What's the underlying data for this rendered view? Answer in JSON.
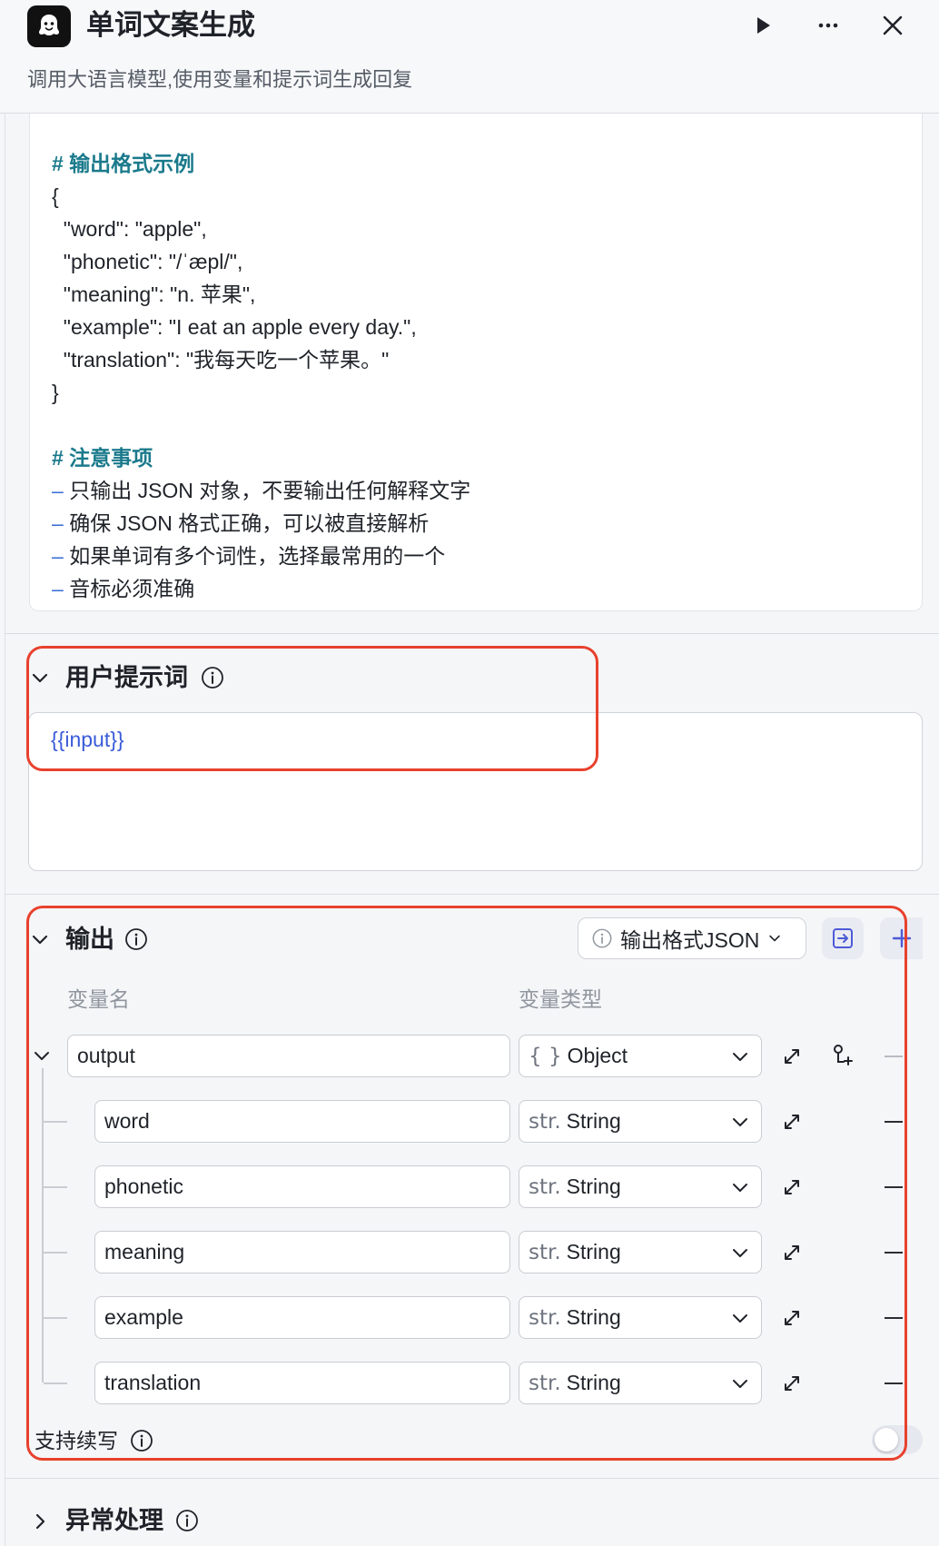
{
  "header": {
    "title": "单词文案生成",
    "subtitle": "调用大语言模型,使用变量和提示词生成回复"
  },
  "system_prompt": {
    "lines": [
      {
        "text": "# 输出格式示例",
        "kind": "heading"
      },
      {
        "text": "{",
        "kind": "code"
      },
      {
        "text": "  \"word\": \"apple\",",
        "kind": "code"
      },
      {
        "text": "  \"phonetic\": \"/ˈæpl/\",",
        "kind": "code"
      },
      {
        "text": "  \"meaning\": \"n. 苹果\",",
        "kind": "code"
      },
      {
        "text": "  \"example\": \"I eat an apple every day.\",",
        "kind": "code"
      },
      {
        "text": "  \"translation\": \"我每天吃一个苹果。\"",
        "kind": "code"
      },
      {
        "text": "}",
        "kind": "code"
      },
      {
        "text": "",
        "kind": "code"
      },
      {
        "text": "# 注意事项",
        "kind": "heading"
      },
      {
        "text": "只输出 JSON 对象，不要输出任何解释文字",
        "kind": "bullet"
      },
      {
        "text": "确保 JSON 格式正确，可以被直接解析",
        "kind": "bullet"
      },
      {
        "text": "如果单词有多个词性，选择最常用的一个",
        "kind": "bullet"
      },
      {
        "text": "音标必须准确",
        "kind": "bullet"
      }
    ],
    "bullet_mark": "–"
  },
  "user_prompt": {
    "title": "用户提示词",
    "value": "{{input}}"
  },
  "output": {
    "title": "输出",
    "format_button": "输出格式JSON",
    "col_name": "变量名",
    "col_type": "变量类型",
    "root": {
      "name": "output",
      "type_prefix": "{ }",
      "type": "Object"
    },
    "children": [
      {
        "name": "word",
        "type_prefix": "str.",
        "type": "String"
      },
      {
        "name": "phonetic",
        "type_prefix": "str.",
        "type": "String"
      },
      {
        "name": "meaning",
        "type_prefix": "str.",
        "type": "String"
      },
      {
        "name": "example",
        "type_prefix": "str.",
        "type": "String"
      },
      {
        "name": "translation",
        "type_prefix": "str.",
        "type": "String"
      }
    ],
    "continue_label": "支持续写",
    "continue_enabled": false
  },
  "error_handling": {
    "title": "异常处理"
  },
  "colors": {
    "highlight_box": "#e8412e",
    "heading_teal": "#1b7a8c",
    "variable_blue": "#3a5bd9",
    "accent_blue": "#4d5bd6"
  },
  "icons": {
    "logo": "bot-logo-icon",
    "run": "play-icon",
    "more": "more-horizontal-icon",
    "close": "close-icon"
  }
}
